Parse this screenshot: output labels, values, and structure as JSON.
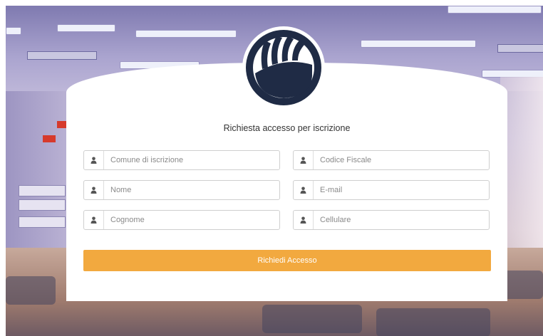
{
  "form": {
    "title": "Richiesta accesso per iscrizione",
    "fields": [
      {
        "placeholder": "Comune di iscrizione",
        "icon": "user-icon"
      },
      {
        "placeholder": "Codice Fiscale",
        "icon": "user-icon"
      },
      {
        "placeholder": "Nome",
        "icon": "user-icon"
      },
      {
        "placeholder": "E-mail",
        "icon": "user-icon"
      },
      {
        "placeholder": "Cognome",
        "icon": "user-icon"
      },
      {
        "placeholder": "Cellulare",
        "icon": "user-icon"
      }
    ],
    "submit_label": "Richiedi Accesso"
  },
  "colors": {
    "accent": "#f2a93f",
    "logo": "#1f2b45",
    "card": "#ffffff"
  }
}
